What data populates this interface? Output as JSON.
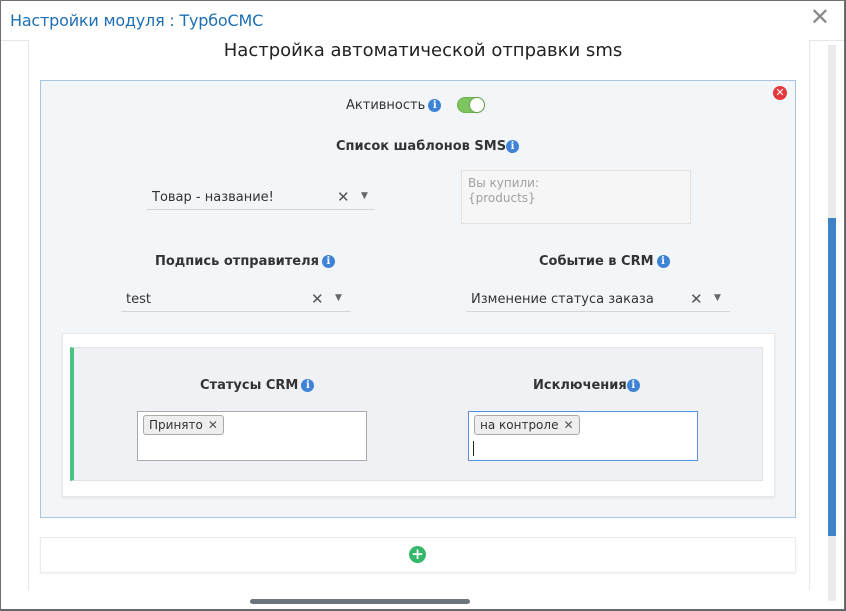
{
  "modal": {
    "title": "Настройки модуля : ТурбоСМС",
    "close_glyph": "✕"
  },
  "page": {
    "section_title": "Настройка автоматической отправки sms"
  },
  "rule": {
    "remove_glyph": "✕",
    "active": {
      "label": "Активность",
      "enabled": true
    },
    "templates": {
      "label": "Список шаблонов SMS",
      "selected": "Товар - название!",
      "preview_lines": [
        "Вы купили:",
        "{products}"
      ]
    },
    "sender": {
      "label": "Подпись отправителя",
      "selected": "test"
    },
    "event": {
      "label": "Событие в CRM",
      "selected": "Изменение статуса заказа"
    },
    "conditions": {
      "statuses_label": "Статусы CRM",
      "statuses": [
        "Принято"
      ],
      "exclusions_label": "Исключения",
      "exclusions": [
        "на контроле"
      ]
    }
  },
  "icons": {
    "info": "i",
    "clear": "✕",
    "dropdown": "▼",
    "tag_remove": "✕",
    "add": "+"
  },
  "colors": {
    "title": "#1f6fb5",
    "toggle_on": "#7ec55f",
    "accent_stripe": "#4cc281",
    "remove": "#e3383d",
    "add": "#35b86b",
    "scroll_thumb": "#3d84c6"
  }
}
